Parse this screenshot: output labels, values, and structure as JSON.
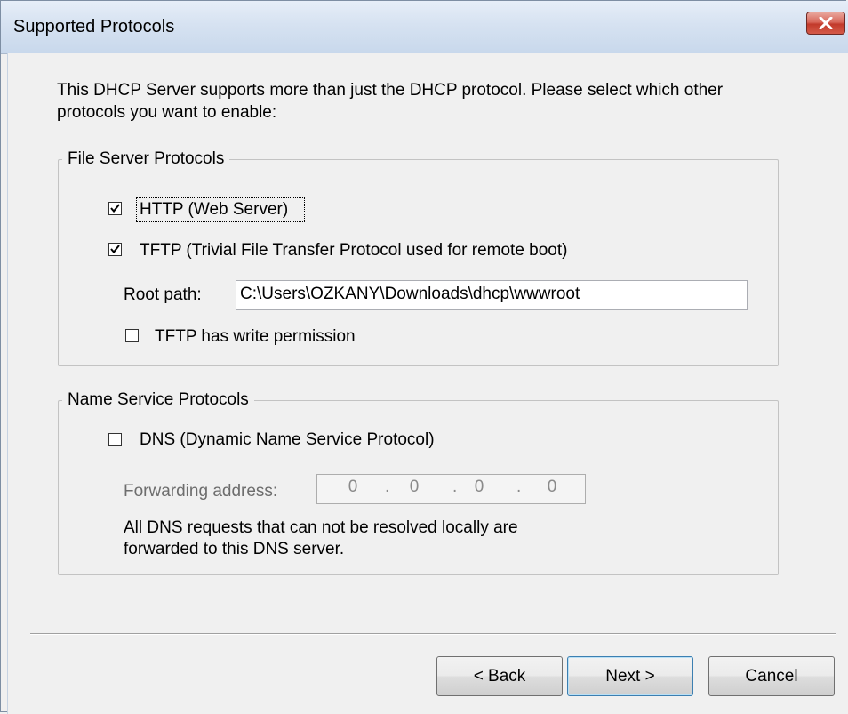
{
  "window": {
    "title": "Supported Protocols"
  },
  "intro": "This DHCP Server supports more than just the DHCP protocol. Please select which other protocols you want to enable:",
  "file_server": {
    "legend": "File Server Protocols",
    "http": {
      "label": "HTTP (Web Server)",
      "checked": true
    },
    "tftp": {
      "label": "TFTP (Trivial File Transfer Protocol used for remote boot)",
      "checked": true
    },
    "root_path_label": "Root path:",
    "root_path_value": "C:\\Users\\OZKANY\\Downloads\\dhcp\\wwwroot",
    "write_perm": {
      "label": "TFTP has write permission",
      "checked": false
    }
  },
  "name_service": {
    "legend": "Name Service Protocols",
    "dns": {
      "label": "DNS (Dynamic Name Service Protocol)",
      "checked": false
    },
    "forwarding_label": "Forwarding address:",
    "forwarding_octets": [
      "0",
      "0",
      "0",
      "0"
    ],
    "note_line1": "All DNS requests that can not be resolved locally are",
    "note_line2": "forwarded to this DNS server."
  },
  "buttons": {
    "back": "< Back",
    "next": "Next >",
    "cancel": "Cancel"
  },
  "colors": {
    "close_button": "#c23a2b",
    "titlebar": "#d6e2f1",
    "background": "#f0f0f0"
  },
  "icons": {
    "checkmark": "check-icon",
    "close": "close-icon"
  }
}
